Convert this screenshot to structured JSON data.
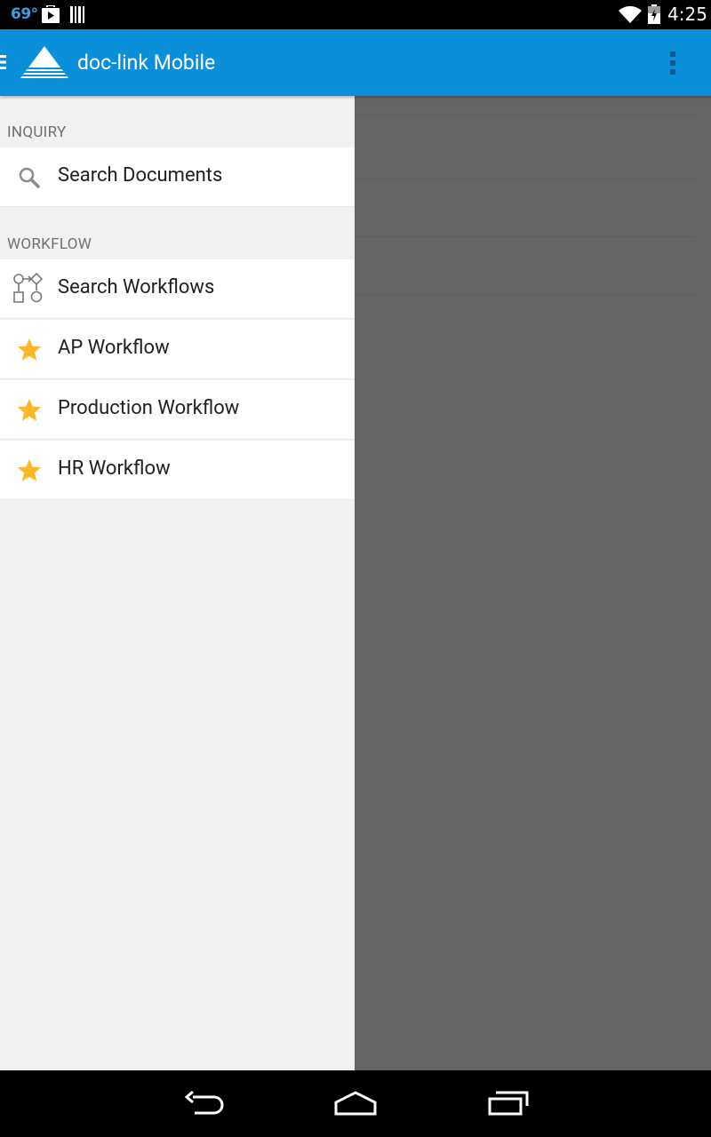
{
  "status_bar": {
    "temperature": "69°",
    "time": "4:25",
    "icons": [
      "play-store-icon",
      "barcode-icon",
      "wifi-icon",
      "battery-icon"
    ]
  },
  "app_bar": {
    "title": "doc-link Mobile",
    "accent_color": "#0a8fd8",
    "icons": [
      "drawer-menu-icon",
      "doc-link-logo-icon",
      "overflow-menu-icon"
    ]
  },
  "drawer": {
    "sections": [
      {
        "header": "INQUIRY",
        "items": [
          {
            "label": "Search Documents",
            "icon": "search-icon"
          }
        ]
      },
      {
        "header": "WORKFLOW",
        "items": [
          {
            "label": "Search Workflows",
            "icon": "workflow-icon"
          },
          {
            "label": "AP Workflow",
            "icon": "star-icon"
          },
          {
            "label": "Production Workflow",
            "icon": "star-icon"
          },
          {
            "label": "HR Workflow",
            "icon": "star-icon"
          }
        ]
      }
    ],
    "star_color": "#fbb829"
  },
  "nav_bar": {
    "buttons": [
      "back-icon",
      "home-icon",
      "recents-icon"
    ]
  }
}
